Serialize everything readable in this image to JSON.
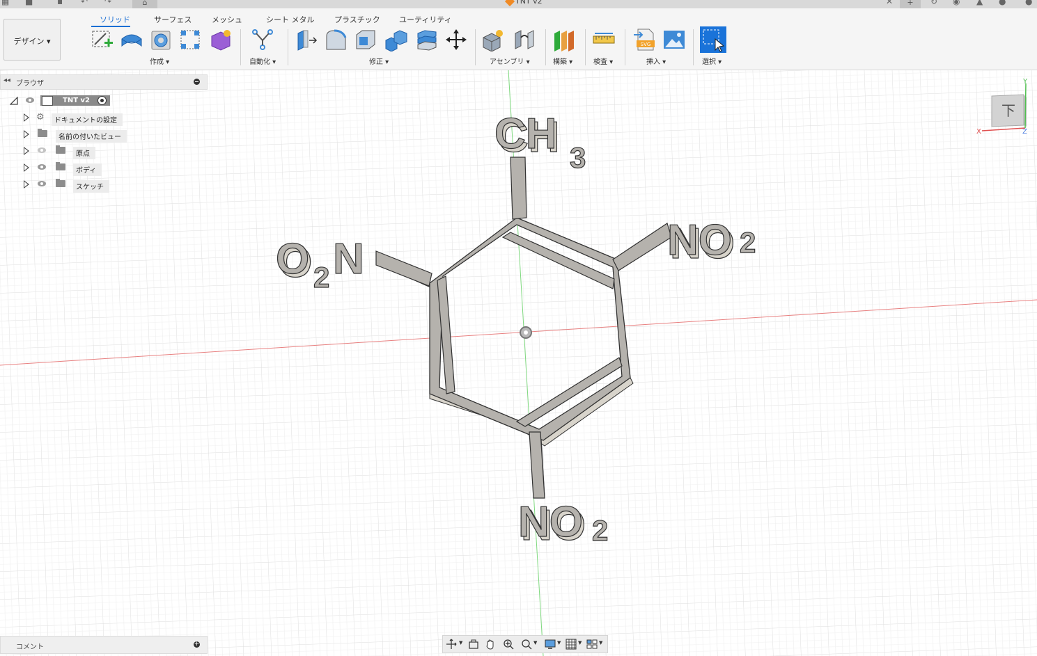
{
  "window": {
    "title": "TNT v2"
  },
  "workspace": {
    "label": "デザイン ▾"
  },
  "tabs": [
    "ソリッド",
    "サーフェス",
    "メッシュ",
    "シート メタル",
    "プラスチック",
    "ユーティリティ"
  ],
  "groups": {
    "create": "作成 ▾",
    "automate": "自動化 ▾",
    "modify": "修正 ▾",
    "assemble": "アセンブリ ▾",
    "construct": "構築 ▾",
    "inspect": "検査 ▾",
    "insert": "挿入 ▾",
    "select": "選択 ▾"
  },
  "browser": {
    "title": "ブラウザ",
    "root": "TNT v2",
    "items": [
      "ドキュメントの設定",
      "名前の付いたビュー",
      "原点",
      "ボディ",
      "スケッチ"
    ]
  },
  "comments": {
    "title": "コメント"
  },
  "viewcube": {
    "face": "下",
    "axes": {
      "x": "X",
      "y": "Y",
      "z": "Z"
    }
  },
  "model": {
    "labels": {
      "top": "CH",
      "top_sub": "3",
      "right": "NO",
      "right_sub": "2",
      "left_a": "O",
      "left_sub": "2",
      "left_b": "N",
      "bottom": "NO",
      "bottom_sub": "2"
    },
    "colors": {
      "face": "#b5b2ad",
      "side": "#d3cfc5",
      "edge": "#333333"
    }
  },
  "colors": {
    "accent": "#1b6fd4",
    "grid": "#e6e6e6",
    "axis_x": "#e05050",
    "axis_y": "#50c050"
  }
}
